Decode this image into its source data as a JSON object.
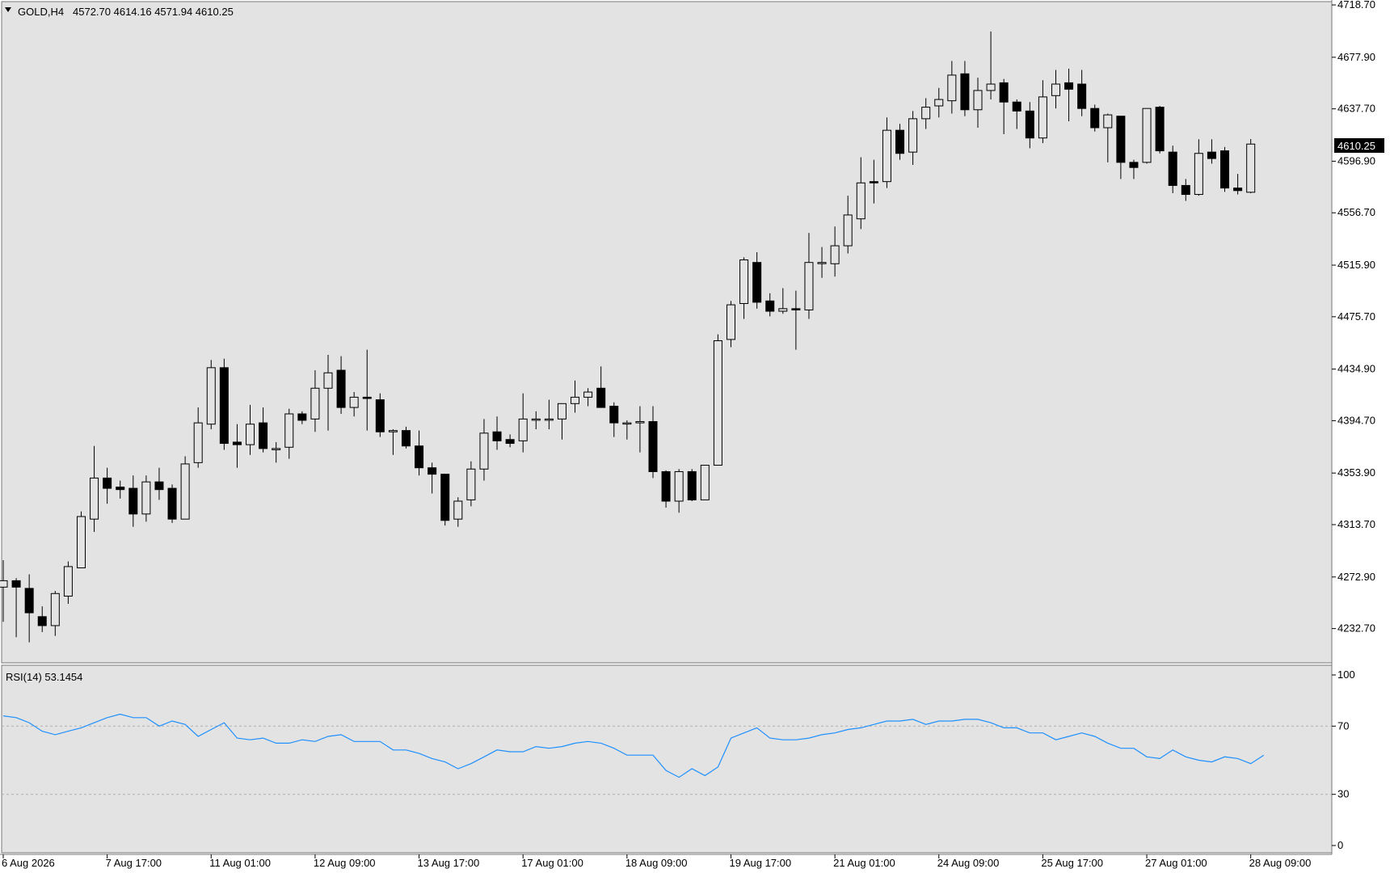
{
  "symbol_header": {
    "symbol": "GOLD,H4",
    "ohlc": "4572.70 4614.16 4571.94 4610.25"
  },
  "current_price_label": "4610.25",
  "price_axis_labels": [
    "4718.70",
    "4677.90",
    "4637.70",
    "4596.90",
    "4556.70",
    "4515.90",
    "4475.70",
    "4434.90",
    "4394.70",
    "4353.90",
    "4313.70",
    "4272.90",
    "4232.70"
  ],
  "rsi_header": "RSI(14) 53.1454",
  "rsi_axis_labels": [
    "100",
    "70",
    "30",
    "0"
  ],
  "time_axis_labels": [
    "6 Aug 2026",
    "7 Aug 17:00",
    "11 Aug 01:00",
    "12 Aug 09:00",
    "13 Aug 17:00",
    "17 Aug 01:00",
    "18 Aug 09:00",
    "19 Aug 17:00",
    "21 Aug 01:00",
    "24 Aug 09:00",
    "25 Aug 17:00",
    "27 Aug 01:00",
    "28 Aug 09:00"
  ],
  "colors": {
    "background": "#e3e3e3",
    "bull_body": "#e3e3e3",
    "bear_body": "#000000",
    "wick": "#000000",
    "rsi_line": "#1e90ff",
    "level_line": "#b0b0b0"
  },
  "chart_data": {
    "type": "candlestick",
    "price_range": [
      4206,
      4720
    ],
    "rsi_range": [
      0,
      100
    ],
    "rsi_levels": [
      30,
      70
    ],
    "candles": [
      {
        "o": 4265,
        "h": 4286,
        "l": 4238,
        "c": 4270
      },
      {
        "o": 4270,
        "h": 4272,
        "l": 4226,
        "c": 4265
      },
      {
        "o": 4264,
        "h": 4275,
        "l": 4222,
        "c": 4245
      },
      {
        "o": 4242,
        "h": 4250,
        "l": 4230,
        "c": 4235
      },
      {
        "o": 4235,
        "h": 4262,
        "l": 4227,
        "c": 4260
      },
      {
        "o": 4258,
        "h": 4285,
        "l": 4252,
        "c": 4281
      },
      {
        "o": 4280,
        "h": 4324,
        "l": 4280,
        "c": 4320
      },
      {
        "o": 4318,
        "h": 4375,
        "l": 4308,
        "c": 4350
      },
      {
        "o": 4350,
        "h": 4358,
        "l": 4330,
        "c": 4342
      },
      {
        "o": 4343,
        "h": 4348,
        "l": 4334,
        "c": 4341
      },
      {
        "o": 4342,
        "h": 4352,
        "l": 4312,
        "c": 4322
      },
      {
        "o": 4322,
        "h": 4352,
        "l": 4316,
        "c": 4347
      },
      {
        "o": 4347,
        "h": 4358,
        "l": 4333,
        "c": 4341
      },
      {
        "o": 4342,
        "h": 4345,
        "l": 4315,
        "c": 4318
      },
      {
        "o": 4318,
        "h": 4367,
        "l": 4318,
        "c": 4361
      },
      {
        "o": 4362,
        "h": 4405,
        "l": 4358,
        "c": 4393
      },
      {
        "o": 4392,
        "h": 4442,
        "l": 4388,
        "c": 4436
      },
      {
        "o": 4436,
        "h": 4443,
        "l": 4372,
        "c": 4377
      },
      {
        "o": 4378,
        "h": 4392,
        "l": 4358,
        "c": 4376
      },
      {
        "o": 4376,
        "h": 4407,
        "l": 4368,
        "c": 4392
      },
      {
        "o": 4393,
        "h": 4405,
        "l": 4370,
        "c": 4373
      },
      {
        "o": 4373,
        "h": 4378,
        "l": 4362,
        "c": 4373
      },
      {
        "o": 4374,
        "h": 4404,
        "l": 4365,
        "c": 4400
      },
      {
        "o": 4400,
        "h": 4402,
        "l": 4392,
        "c": 4395
      },
      {
        "o": 4396,
        "h": 4434,
        "l": 4386,
        "c": 4420
      },
      {
        "o": 4420,
        "h": 4446,
        "l": 4387,
        "c": 4432
      },
      {
        "o": 4434,
        "h": 4445,
        "l": 4400,
        "c": 4405
      },
      {
        "o": 4405,
        "h": 4417,
        "l": 4398,
        "c": 4413
      },
      {
        "o": 4413,
        "h": 4450,
        "l": 4387,
        "c": 4412
      },
      {
        "o": 4411,
        "h": 4416,
        "l": 4382,
        "c": 4386
      },
      {
        "o": 4386,
        "h": 4388,
        "l": 4368,
        "c": 4387
      },
      {
        "o": 4387,
        "h": 4390,
        "l": 4373,
        "c": 4375
      },
      {
        "o": 4375,
        "h": 4387,
        "l": 4352,
        "c": 4358
      },
      {
        "o": 4358,
        "h": 4362,
        "l": 4338,
        "c": 4353
      },
      {
        "o": 4353,
        "h": 4353,
        "l": 4313,
        "c": 4317
      },
      {
        "o": 4318,
        "h": 4335,
        "l": 4312,
        "c": 4332
      },
      {
        "o": 4333,
        "h": 4363,
        "l": 4328,
        "c": 4357
      },
      {
        "o": 4357,
        "h": 4396,
        "l": 4348,
        "c": 4385
      },
      {
        "o": 4386,
        "h": 4398,
        "l": 4372,
        "c": 4379
      },
      {
        "o": 4380,
        "h": 4384,
        "l": 4374,
        "c": 4377
      },
      {
        "o": 4379,
        "h": 4416,
        "l": 4370,
        "c": 4396
      },
      {
        "o": 4396,
        "h": 4402,
        "l": 4388,
        "c": 4396
      },
      {
        "o": 4396,
        "h": 4411,
        "l": 4388,
        "c": 4396
      },
      {
        "o": 4396,
        "h": 4404,
        "l": 4380,
        "c": 4408
      },
      {
        "o": 4408,
        "h": 4426,
        "l": 4401,
        "c": 4413
      },
      {
        "o": 4413,
        "h": 4420,
        "l": 4406,
        "c": 4417
      },
      {
        "o": 4420,
        "h": 4437,
        "l": 4410,
        "c": 4405
      },
      {
        "o": 4406,
        "h": 4409,
        "l": 4382,
        "c": 4393
      },
      {
        "o": 4393,
        "h": 4395,
        "l": 4380,
        "c": 4393
      },
      {
        "o": 4393,
        "h": 4406,
        "l": 4370,
        "c": 4394
      },
      {
        "o": 4394,
        "h": 4406,
        "l": 4350,
        "c": 4355
      },
      {
        "o": 4355,
        "h": 4356,
        "l": 4327,
        "c": 4332
      },
      {
        "o": 4332,
        "h": 4357,
        "l": 4323,
        "c": 4355
      },
      {
        "o": 4355,
        "h": 4357,
        "l": 4332,
        "c": 4333
      },
      {
        "o": 4333,
        "h": 4360,
        "l": 4333,
        "c": 4360
      },
      {
        "o": 4360,
        "h": 4462,
        "l": 4360,
        "c": 4457
      },
      {
        "o": 4458,
        "h": 4488,
        "l": 4452,
        "c": 4485
      },
      {
        "o": 4486,
        "h": 4522,
        "l": 4474,
        "c": 4520
      },
      {
        "o": 4518,
        "h": 4526,
        "l": 4482,
        "c": 4487
      },
      {
        "o": 4488,
        "h": 4494,
        "l": 4476,
        "c": 4480
      },
      {
        "o": 4480,
        "h": 4498,
        "l": 4478,
        "c": 4482
      },
      {
        "o": 4482,
        "h": 4496,
        "l": 4450,
        "c": 4481
      },
      {
        "o": 4481,
        "h": 4541,
        "l": 4474,
        "c": 4518
      },
      {
        "o": 4518,
        "h": 4530,
        "l": 4506,
        "c": 4518
      },
      {
        "o": 4517,
        "h": 4546,
        "l": 4507,
        "c": 4531
      },
      {
        "o": 4531,
        "h": 4570,
        "l": 4525,
        "c": 4555
      },
      {
        "o": 4552,
        "h": 4600,
        "l": 4544,
        "c": 4580
      },
      {
        "o": 4581,
        "h": 4598,
        "l": 4564,
        "c": 4580
      },
      {
        "o": 4581,
        "h": 4631,
        "l": 4576,
        "c": 4621
      },
      {
        "o": 4621,
        "h": 4626,
        "l": 4598,
        "c": 4603
      },
      {
        "o": 4604,
        "h": 4636,
        "l": 4594,
        "c": 4630
      },
      {
        "o": 4630,
        "h": 4646,
        "l": 4622,
        "c": 4639
      },
      {
        "o": 4640,
        "h": 4654,
        "l": 4631,
        "c": 4645
      },
      {
        "o": 4644,
        "h": 4675,
        "l": 4634,
        "c": 4664
      },
      {
        "o": 4665,
        "h": 4675,
        "l": 4632,
        "c": 4637
      },
      {
        "o": 4637,
        "h": 4662,
        "l": 4623,
        "c": 4652
      },
      {
        "o": 4652,
        "h": 4698,
        "l": 4645,
        "c": 4657
      },
      {
        "o": 4658,
        "h": 4661,
        "l": 4618,
        "c": 4643
      },
      {
        "o": 4643,
        "h": 4645,
        "l": 4622,
        "c": 4636
      },
      {
        "o": 4636,
        "h": 4643,
        "l": 4607,
        "c": 4615
      },
      {
        "o": 4615,
        "h": 4660,
        "l": 4611,
        "c": 4647
      },
      {
        "o": 4648,
        "h": 4668,
        "l": 4638,
        "c": 4657
      },
      {
        "o": 4658,
        "h": 4669,
        "l": 4628,
        "c": 4653
      },
      {
        "o": 4657,
        "h": 4668,
        "l": 4632,
        "c": 4638
      },
      {
        "o": 4638,
        "h": 4641,
        "l": 4620,
        "c": 4623
      },
      {
        "o": 4623,
        "h": 4634,
        "l": 4596,
        "c": 4633
      },
      {
        "o": 4632,
        "h": 4632,
        "l": 4583,
        "c": 4596
      },
      {
        "o": 4596,
        "h": 4598,
        "l": 4583,
        "c": 4592
      },
      {
        "o": 4596,
        "h": 4638,
        "l": 4595,
        "c": 4638
      },
      {
        "o": 4639,
        "h": 4640,
        "l": 4603,
        "c": 4605
      },
      {
        "o": 4604,
        "h": 4609,
        "l": 4572,
        "c": 4578
      },
      {
        "o": 4578,
        "h": 4583,
        "l": 4566,
        "c": 4571
      },
      {
        "o": 4571,
        "h": 4614,
        "l": 4570,
        "c": 4603
      },
      {
        "o": 4604,
        "h": 4614,
        "l": 4595,
        "c": 4599
      },
      {
        "o": 4605,
        "h": 4608,
        "l": 4573,
        "c": 4576
      },
      {
        "o": 4576,
        "h": 4587,
        "l": 4571,
        "c": 4574
      },
      {
        "o": 4572.7,
        "h": 4614.16,
        "l": 4571.94,
        "c": 4610.25
      }
    ],
    "rsi": [
      76,
      75,
      72,
      67,
      65,
      67,
      69,
      72,
      75,
      77,
      75,
      75,
      70,
      73,
      71,
      64,
      68,
      72,
      63,
      62,
      63,
      60,
      60,
      62,
      61,
      64,
      65,
      61,
      61,
      61,
      56,
      56,
      54,
      51,
      49,
      45,
      48,
      52,
      56,
      55,
      55,
      58,
      57,
      58,
      60,
      61,
      60,
      57,
      53,
      53,
      53,
      44,
      40,
      45,
      41,
      46,
      63,
      66,
      69,
      63,
      62,
      62,
      63,
      65,
      66,
      68,
      69,
      71,
      73,
      73,
      74,
      71,
      73,
      73,
      74,
      74,
      72,
      69,
      69,
      66,
      66,
      62,
      64,
      66,
      64,
      60,
      57,
      57,
      52,
      51,
      56,
      52,
      50,
      49,
      52,
      51,
      48,
      53
    ]
  }
}
